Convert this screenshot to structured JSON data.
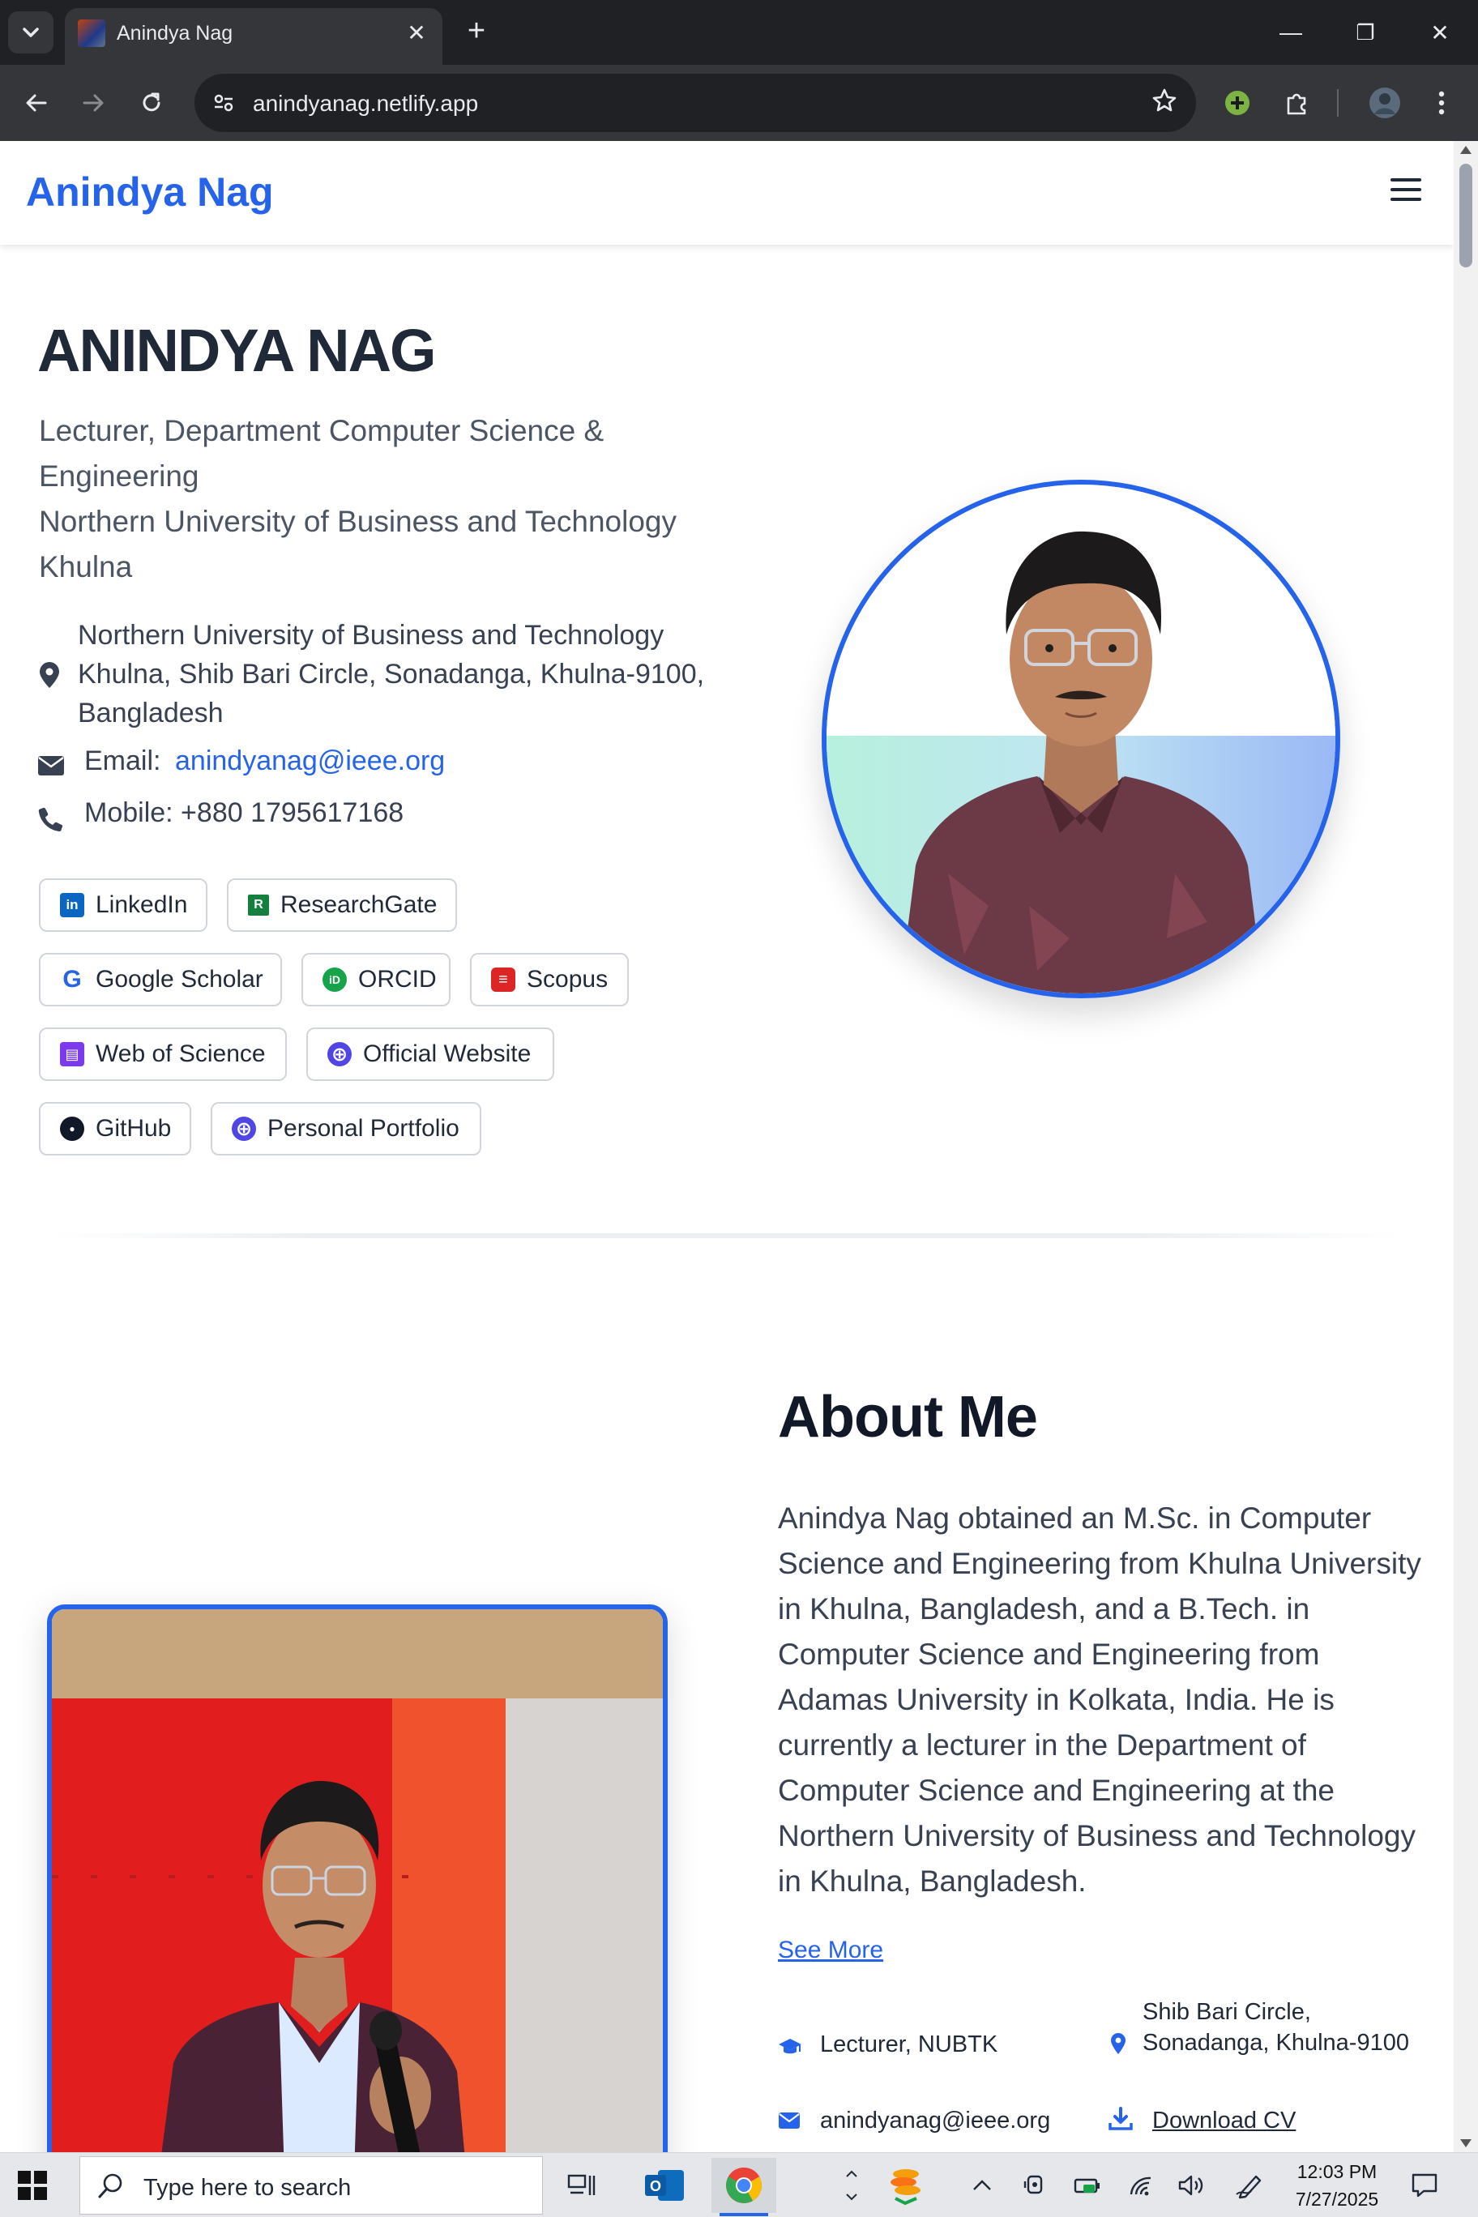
{
  "browser": {
    "tab_title": "Anindya Nag",
    "tab_close": "✕",
    "new_tab": "+",
    "url": "anindyanag.netlify.app",
    "window_controls": {
      "minimize": "—",
      "restore": "❐",
      "close": "✕"
    },
    "icons": [
      "tab-list-icon",
      "back-arrow-icon",
      "forward-arrow-icon",
      "reload-icon",
      "site-info-icon",
      "star-icon",
      "extension-green-icon",
      "puzzle-icon",
      "profile-avatar-icon",
      "kebab-menu-icon"
    ]
  },
  "header": {
    "brand": "Anindya Nag"
  },
  "hero": {
    "name": "ANINDYA NAG",
    "title_lines": [
      "Lecturer, Department Computer Science &",
      "Engineering",
      "Northern University of Business and Technology",
      "Khulna"
    ],
    "address_lines": [
      "Northern University of Business and Technology",
      "Khulna, Shib Bari Circle, Sonadanga, Khulna-9100,",
      "Bangladesh"
    ],
    "email_label": "Email:",
    "email": "anindyanag@ieee.org",
    "mobile": "Mobile: +880 1795617168"
  },
  "social_links": [
    {
      "label": "LinkedIn",
      "color": "#0a66c2",
      "glyph": "in"
    },
    {
      "label": "ResearchGate",
      "color": "#15803d",
      "glyph": "R"
    },
    {
      "label": "Google Scholar",
      "color": "#2563eb",
      "glyph": "G"
    },
    {
      "label": "ORCID",
      "color": "#16a34a",
      "glyph": "iD"
    },
    {
      "label": "Scopus",
      "color": "#dc2626",
      "glyph": "≡"
    },
    {
      "label": "Web of Science",
      "color": "#7c3aed",
      "glyph": "▤"
    },
    {
      "label": "Official Website",
      "color": "#4f46e5",
      "glyph": "⊕"
    },
    {
      "label": "GitHub",
      "color": "#111827",
      "glyph": "●"
    },
    {
      "label": "Personal Portfolio",
      "color": "#4f46e5",
      "glyph": "⊕"
    }
  ],
  "about": {
    "heading": "About Me",
    "body": "Anindya Nag obtained an M.Sc. in Computer Science and Engineering from Khulna University in Khulna, Bangladesh, and a B.Tech. in Computer Science and Engineering from Adamas University in Kolkata, India. He is currently a lecturer in the Department of Computer Science and Engineering at the Northern University of Business and Technology in Khulna, Bangladesh.",
    "see_more": "See More",
    "position": "Lecturer, NUBTK",
    "location_lines": [
      "Shib Bari Circle,",
      "Sonadanga, Khulna-9100"
    ],
    "email": "anindyanag@ieee.org",
    "download_cv": "Download CV"
  },
  "taskbar": {
    "search_placeholder": "Type here to search",
    "time": "12:03 PM",
    "date": "7/27/2025"
  },
  "colors": {
    "accent": "#2563eb",
    "text": "#1f2937",
    "muted": "#4b5563"
  }
}
